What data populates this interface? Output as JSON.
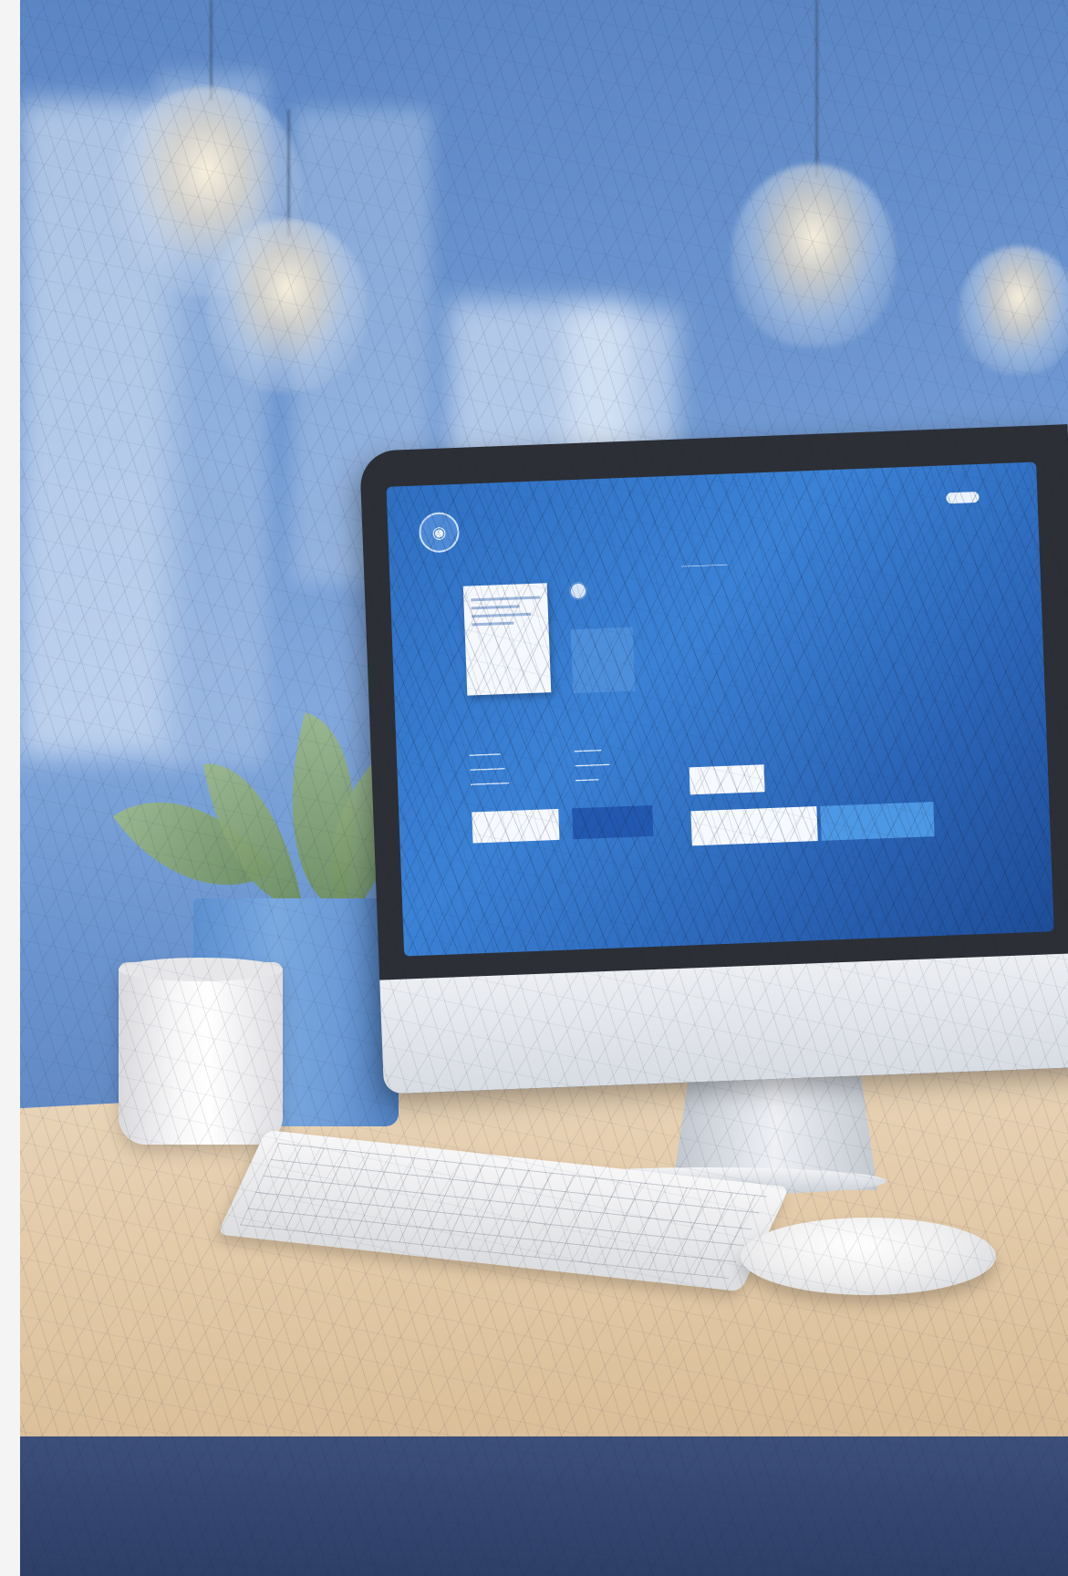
{
  "screen": {
    "brand_text": "",
    "header_button": "",
    "hero_title": "",
    "hero_body": "",
    "doc_card_text": "",
    "info_card_text": "",
    "buttons": [
      "",
      "",
      "",
      ""
    ]
  },
  "colors": {
    "wall": "#6f98d2",
    "screen_blue": "#3b82d6",
    "desk_wood": "#e3caa8",
    "pot_blue": "#7aa9e0"
  },
  "icons": {
    "site_logo": "globe-icon"
  }
}
